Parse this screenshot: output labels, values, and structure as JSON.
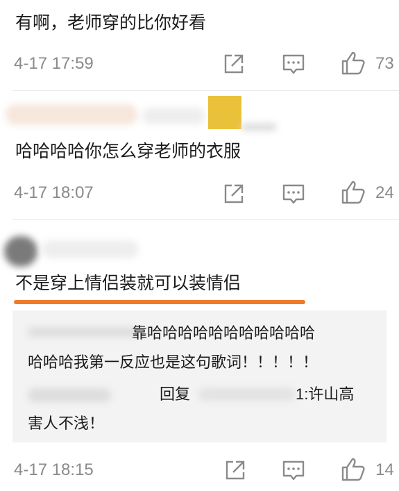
{
  "comments": [
    {
      "text": "有啊，老师穿的比你好看",
      "time": "4-17 17:59",
      "likes": "73"
    },
    {
      "text": "哈哈哈哈你怎么穿老师的衣服",
      "time": "4-17 18:07",
      "likes": "24"
    },
    {
      "text": "不是穿上情侣装就可以装情侣",
      "time": "4-17 18:15",
      "likes": "14",
      "replies": [
        {
          "line1": "靠哈哈哈哈哈哈哈哈哈哈哈",
          "line2": "哈哈哈我第一反应也是这句歌词！！！！！"
        },
        {
          "line1_prefix": "回复",
          "line1_suffix": "1:许山高",
          "line2": "害人不浅！"
        }
      ]
    }
  ],
  "icons": {
    "share": "share-icon",
    "reply": "comment-icon",
    "like": "thumbs-up-icon"
  },
  "colors": {
    "accent_underline": "#f07a2a",
    "meta_gray": "#8a8a8a",
    "reply_bg": "#f3f3f3"
  }
}
